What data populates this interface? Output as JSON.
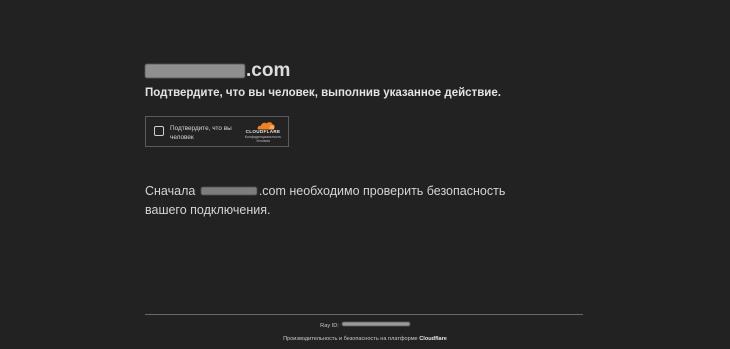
{
  "header": {
    "domain_suffix": ".com",
    "subtitle": "Подтвердите, что вы человек, выполнив указанное действие."
  },
  "widget": {
    "checkbox_label": "Подтвердите, что вы человек",
    "brand_name": "CLOUDFLARE",
    "brand_link": "Конфиденциальность Условия",
    "brand_color": "#f38020"
  },
  "message": {
    "prefix": "Сначала",
    "suffix": ".com необходимо проверить безопасность вашего подключения."
  },
  "footer": {
    "ray_label": "Ray ID:",
    "performance_text": "Производительность и безопасность на платформе",
    "performance_brand": "Cloudflare"
  }
}
